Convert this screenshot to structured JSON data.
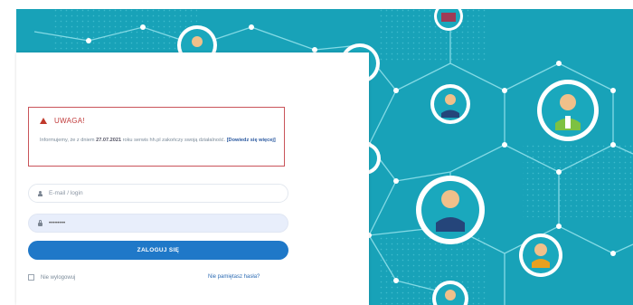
{
  "warning": {
    "title": "UWAGA!",
    "text_before": "Informujemy, że z dniem ",
    "date": "27.07.2021",
    "text_after": " roku serwis hh.pl zakończy swoją działalność.",
    "link": "[Dowiedz się więcej]"
  },
  "login_form": {
    "email_placeholder": "E-mail / login",
    "password_value": "••••••••",
    "submit_label": "ZALOGUJ SIĘ",
    "remember_label": "Nie wylogowuj",
    "forgot_label": "Nie pamiętasz hasła?"
  },
  "icons": {
    "warning": "warning-triangle-icon",
    "user": "user-icon",
    "lock": "lock-icon",
    "checkbox": "checkbox"
  },
  "colors": {
    "background": "#18a2b8",
    "warning_border": "#c9545a",
    "button": "#1f78c8",
    "link": "#2c6bb3"
  }
}
